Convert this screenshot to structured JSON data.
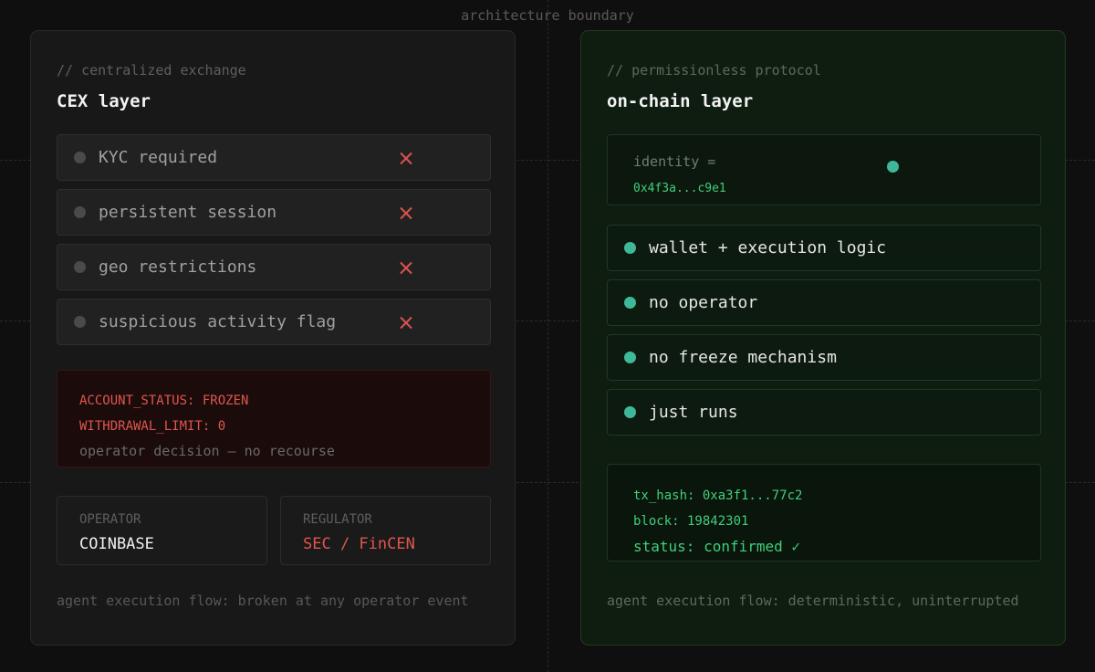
{
  "boundary_label": "architecture boundary",
  "cex": {
    "comment": "// centralized exchange",
    "title": "CEX layer",
    "items": [
      {
        "label": "KYC required"
      },
      {
        "label": "persistent session"
      },
      {
        "label": "geo restrictions"
      },
      {
        "label": "suspicious activity flag"
      }
    ],
    "status": {
      "line1": "ACCOUNT_STATUS: FROZEN",
      "line2": "WITHDRAWAL_LIMIT: 0",
      "line3": "operator decision — no recourse"
    },
    "operator": {
      "caption": "OPERATOR",
      "value": "COINBASE"
    },
    "regulator": {
      "caption": "REGULATOR",
      "value": "SEC / FinCEN"
    },
    "footer": "agent execution flow: broken at any operator event"
  },
  "chain": {
    "comment": "// permissionless protocol",
    "title": "on-chain layer",
    "identity": {
      "label": "identity =",
      "value": "0x4f3a...c9e1"
    },
    "items": [
      {
        "label": "wallet + execution logic"
      },
      {
        "label": "no operator"
      },
      {
        "label": "no freeze mechanism"
      },
      {
        "label": "just runs"
      }
    ],
    "tx": {
      "line1": "tx_hash: 0xa3f1...77c2",
      "line2": "block: 19842301",
      "line3": "status: confirmed ✓"
    },
    "footer": "agent execution flow: deterministic, uninterrupted"
  },
  "colors": {
    "danger": "#e0564e",
    "success": "#3fcf7a",
    "accent_dot": "#3fb89a"
  }
}
